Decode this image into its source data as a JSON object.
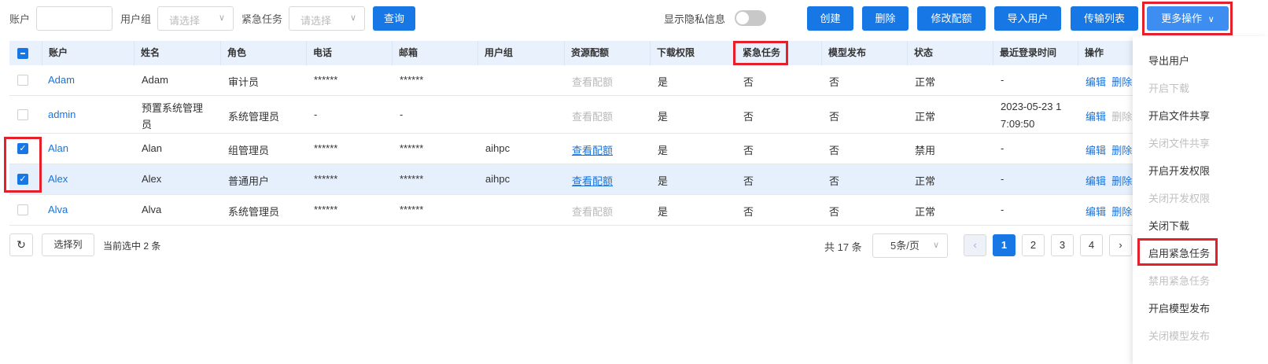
{
  "filters": {
    "account_label": "账户",
    "group_label": "用户组",
    "group_placeholder": "请选择",
    "urgent_label": "紧急任务",
    "urgent_placeholder": "请选择",
    "query_button": "查询"
  },
  "privacy_switch_label": "显示隐私信息",
  "actions": {
    "create": "创建",
    "delete": "删除",
    "edit_quota": "修改配额",
    "import_users": "导入用户",
    "transfer_list": "传输列表",
    "more": "更多操作"
  },
  "table": {
    "columns": [
      "账户",
      "姓名",
      "角色",
      "电话",
      "邮箱",
      "用户组",
      "资源配额",
      "下载权限",
      "紧急任务",
      "模型发布",
      "状态",
      "最近登录时间",
      "操作"
    ],
    "rows": [
      {
        "account": "Adam",
        "name": "Adam",
        "role": "审计员",
        "phone": "******",
        "email": "******",
        "group": "",
        "quota": "查看配额",
        "download": "是",
        "urgent": "否",
        "model": "否",
        "status": "正常",
        "last_login": "-",
        "edit": "编辑",
        "delete": "删除"
      },
      {
        "account": "admin",
        "name_line1": "预置系统管理",
        "name_line2": "员",
        "role": "系统管理员",
        "phone": "-",
        "email": "-",
        "group": "",
        "quota": "查看配额",
        "download": "是",
        "urgent": "否",
        "model": "否",
        "status": "正常",
        "last_login_line1": "2023-05-23 1",
        "last_login_line2": "7:09:50",
        "edit": "编辑",
        "delete": "删除"
      },
      {
        "account": "Alan",
        "name": "Alan",
        "role": "组管理员",
        "phone": "******",
        "email": "******",
        "group": "aihpc",
        "quota": "查看配额",
        "download": "是",
        "urgent": "否",
        "model": "否",
        "status": "禁用",
        "last_login": "-",
        "edit": "编辑",
        "delete": "删除"
      },
      {
        "account": "Alex",
        "name": "Alex",
        "role": "普通用户",
        "phone": "******",
        "email": "******",
        "group": "aihpc",
        "quota": "查看配额",
        "download": "是",
        "urgent": "否",
        "model": "否",
        "status": "正常",
        "last_login": "-",
        "edit": "编辑",
        "delete": "删除"
      },
      {
        "account": "Alva",
        "name": "Alva",
        "role": "系统管理员",
        "phone": "******",
        "email": "******",
        "group": "",
        "quota": "查看配额",
        "download": "是",
        "urgent": "否",
        "model": "否",
        "status": "正常",
        "last_login": "-",
        "edit": "编辑",
        "delete": "删除"
      }
    ]
  },
  "footer": {
    "pick_columns": "选择列",
    "selected_text": "当前选中 2 条",
    "total_text": "共 17 条",
    "page_size": "5条/页",
    "pages": [
      "1",
      "2",
      "3",
      "4"
    ]
  },
  "more_menu": [
    {
      "label": "导出用户",
      "disabled": false
    },
    {
      "label": "开启下载",
      "disabled": true
    },
    {
      "label": "开启文件共享",
      "disabled": false
    },
    {
      "label": "关闭文件共享",
      "disabled": true
    },
    {
      "label": "开启开发权限",
      "disabled": false
    },
    {
      "label": "关闭开发权限",
      "disabled": true
    },
    {
      "label": "关闭下载",
      "disabled": false
    },
    {
      "label": "启用紧急任务",
      "disabled": false
    },
    {
      "label": "禁用紧急任务",
      "disabled": true
    },
    {
      "label": "开启模型发布",
      "disabled": false
    },
    {
      "label": "关闭模型发布",
      "disabled": true
    }
  ],
  "colors": {
    "primary": "#1677e5",
    "highlight_red": "#e5202a",
    "selected_row": "#e6f0fc",
    "header_bg": "#e9f1fd"
  }
}
